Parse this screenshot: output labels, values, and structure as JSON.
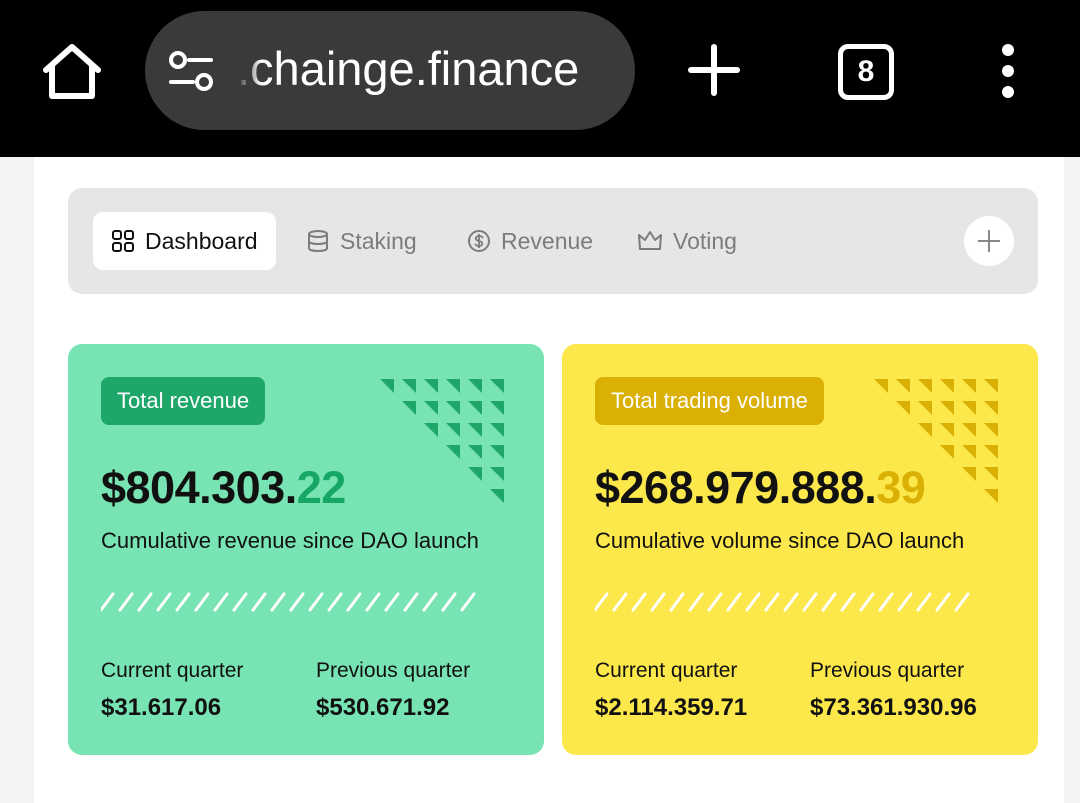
{
  "browser": {
    "url": ".chainge.finance",
    "tab_count": "8"
  },
  "tabs": [
    {
      "label": "Dashboard",
      "active": true,
      "icon": "grid-icon"
    },
    {
      "label": "Staking",
      "active": false,
      "icon": "database-icon"
    },
    {
      "label": "Revenue",
      "active": false,
      "icon": "dollar-circle-icon"
    },
    {
      "label": "Voting",
      "active": false,
      "icon": "crown-icon"
    }
  ],
  "cards": {
    "revenue": {
      "badge": "Total revenue",
      "amount_main": "$804.303.",
      "amount_cents": "22",
      "subtitle": "Cumulative revenue since DAO launch",
      "current_label": "Current quarter",
      "current_value": "$31.617.06",
      "previous_label": "Previous quarter",
      "previous_value": "$530.671.92",
      "accent": "#1fa76a",
      "background": "#78e3b3"
    },
    "volume": {
      "badge": "Total trading volume",
      "amount_main": "$268.979.888.",
      "amount_cents": "39",
      "subtitle": "Cumulative volume since DAO launch",
      "current_label": "Current quarter",
      "current_value": "$2.114.359.71",
      "previous_label": "Previous quarter",
      "previous_value": "$73.361.930.96",
      "accent": "#dbb005",
      "background": "#fde84b"
    }
  }
}
